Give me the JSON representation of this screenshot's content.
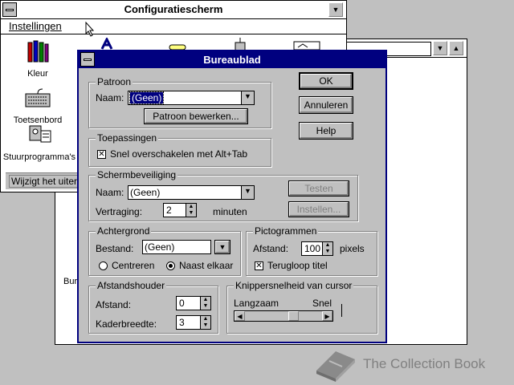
{
  "control_panel": {
    "title": "Configuratiescherm",
    "menu": "Instellingen",
    "icons": [
      {
        "name": "color-icon",
        "label": "Kleur"
      },
      {
        "name": "keyboard-icon",
        "label": "Toetsenbord"
      },
      {
        "name": "drivers-icon",
        "label": "Stuurprogramma's"
      }
    ],
    "status": "Wijzigt het uiterlijk"
  },
  "background_window": {
    "partial_text": "Bure"
  },
  "dialog": {
    "title": "Bureaublad",
    "buttons": {
      "ok": "OK",
      "cancel": "Annuleren",
      "help": "Help"
    },
    "pattern": {
      "legend": "Patroon",
      "name_label": "Naam:",
      "name_value": "(Geen)",
      "edit_button": "Patroon bewerken..."
    },
    "applications": {
      "legend": "Toepassingen",
      "fast_switch_label": "Snel overschakelen met Alt+Tab",
      "fast_switch_checked": true
    },
    "screensaver": {
      "legend": "Schermbeveiliging",
      "name_label": "Naam:",
      "name_value": "(Geen)",
      "test_button": "Testen",
      "setup_button": "Instellen...",
      "delay_label": "Vertraging:",
      "delay_value": "2",
      "delay_unit": "minuten"
    },
    "wallpaper": {
      "legend": "Achtergrond",
      "file_label": "Bestand:",
      "file_value": "(Geen)",
      "center_label": "Centreren",
      "tile_label": "Naast elkaar",
      "selected": "tile"
    },
    "icons": {
      "legend": "Pictogrammen",
      "spacing_label": "Afstand:",
      "spacing_value": "100",
      "spacing_unit": "pixels",
      "wrap_label": "Terugloop titel",
      "wrap_checked": true
    },
    "grid": {
      "legend": "Afstandshouder",
      "spacing_label": "Afstand:",
      "spacing_value": "0",
      "border_label": "Kaderbreedte:",
      "border_value": "3"
    },
    "cursor": {
      "legend": "Knippersnelheid van cursor",
      "slow_label": "Langzaam",
      "fast_label": "Snel",
      "blink_rate": 0.65
    }
  },
  "watermark": {
    "text": "The Collection Book"
  }
}
